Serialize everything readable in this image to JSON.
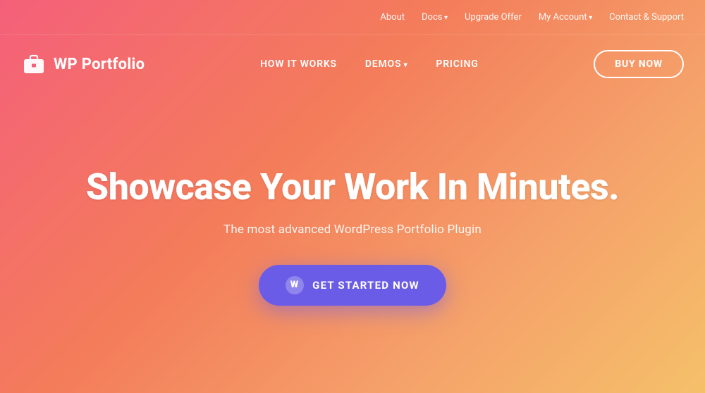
{
  "top_nav": {
    "items": [
      {
        "label": "About",
        "id": "about",
        "has_arrow": false
      },
      {
        "label": "Docs",
        "id": "docs",
        "has_arrow": true
      },
      {
        "label": "Upgrade Offer",
        "id": "upgrade-offer",
        "has_arrow": false
      },
      {
        "label": "My Account",
        "id": "my-account",
        "has_arrow": true
      },
      {
        "label": "Contact & Support",
        "id": "contact-support",
        "has_arrow": false
      }
    ]
  },
  "main_nav": {
    "logo_text": "WP Portfolio",
    "links": [
      {
        "label": "HOW IT WORKS",
        "id": "how-it-works",
        "has_arrow": false
      },
      {
        "label": "DEMOS",
        "id": "demos",
        "has_arrow": true
      },
      {
        "label": "PRICING",
        "id": "pricing",
        "has_arrow": false
      }
    ],
    "cta_label": "BUY NOW"
  },
  "hero": {
    "title": "Showcase Your Work In Minutes.",
    "subtitle": "The most advanced WordPress Portfolio Plugin",
    "cta_label": "GET STARTED NOW",
    "wp_icon_char": "W"
  },
  "colors": {
    "background_start": "#f4607a",
    "background_end": "#f5c06a",
    "cta_bg": "#6b5ce7",
    "text_white": "#ffffff"
  }
}
